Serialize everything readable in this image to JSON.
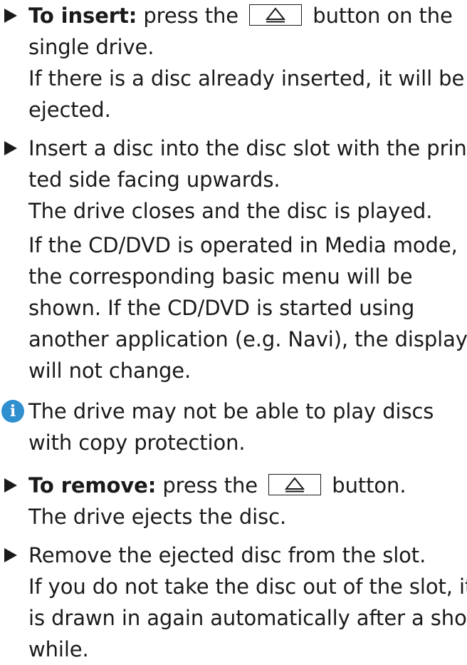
{
  "step1": {
    "label": "To insert:",
    "before_button": " press the",
    "button_icon": "eject-icon",
    "after_button": "button on the",
    "line2": "single drive.",
    "line3": "If there is a disc already inserted, it will be",
    "line4": "ejected."
  },
  "step2": {
    "line1": "Insert a disc into the disc slot with the prin-",
    "line2": "ted side facing upwards.",
    "line3": "The drive closes and the disc is played.",
    "line4": "If the CD/DVD is operated in Media mode,",
    "line5": "the corresponding basic menu will be",
    "line6": "shown. If the CD/DVD is started using",
    "line7": "another application (e.g. Navi), the display",
    "line8": "will not change."
  },
  "note": {
    "icon": "info-icon",
    "icon_glyph": "i",
    "icon_color": "#2f8fcf",
    "line1": "The drive may not be able to play discs",
    "line2": "with copy protection."
  },
  "step3": {
    "label": "To remove:",
    "before_button": " press the",
    "button_icon": "eject-icon",
    "after_button": "button.",
    "line2": "The drive ejects the disc."
  },
  "step4": {
    "line1": "Remove the ejected disc from the slot.",
    "line2": "If you do not take the disc out of the slot, it",
    "line3": "is drawn in again automatically after a short",
    "line4": "while."
  }
}
